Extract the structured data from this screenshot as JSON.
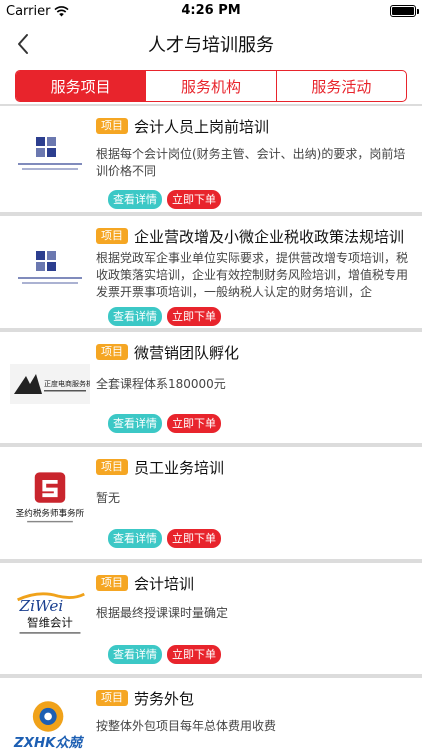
{
  "status": {
    "carrier": "Carrier",
    "time": "4:26 PM",
    "battery_level": 1.0
  },
  "nav": {
    "title": "人才与培训服务",
    "back_icon": "chevron-left-icon"
  },
  "tabs": [
    {
      "label": "服务项目",
      "active": true
    },
    {
      "label": "服务机构",
      "active": false
    },
    {
      "label": "服务活动",
      "active": false
    }
  ],
  "items": [
    {
      "tag": "项目",
      "title": "会计人员上岗前培训",
      "desc": "根据每个会计岗位(财务主管、会计、出纳)的要求，岗前培训价格不同",
      "detail_label": "查看详情",
      "order_label": "立即下单",
      "logo": "zhiyue-logo"
    },
    {
      "tag": "项目",
      "title": "企业营改增及小微企业税收政策法规培训",
      "desc": "根据党政军企事业单位实际要求，提供营改增专项培训，税收政策落实培训，企业有效控制财务风险培训，增值税专用发票开票事项培训，一般纳税人认定的财务培训，企",
      "detail_label": "查看详情",
      "order_label": "立即下单",
      "logo": "zhiyue-logo"
    },
    {
      "tag": "项目",
      "title": "微营销团队孵化",
      "desc": "全套课程体系180000元",
      "detail_label": "查看详情",
      "order_label": "立即下单",
      "logo": "zhengdu-logo",
      "logo_text": "正度电商服务机构"
    },
    {
      "tag": "项目",
      "title": "员工业务培训",
      "desc": "暂无",
      "detail_label": "查看详情",
      "order_label": "立即下单",
      "logo": "shengyue-logo",
      "logo_text": "圣约税务师事务所"
    },
    {
      "tag": "项目",
      "title": "会计培训",
      "desc": "根据最终授课课时量确定",
      "detail_label": "查看详情",
      "order_label": "立即下单",
      "logo": "zhiwei-logo",
      "logo_text": "智维会计"
    },
    {
      "tag": "项目",
      "title": "劳务外包",
      "desc": "按整体外包项目每年总体费用收费",
      "detail_label": "查看详情",
      "order_label": "立即下单",
      "logo": "zxhk-logo",
      "logo_text": "ZXHK众兢"
    }
  ],
  "colors": {
    "accent": "#e8242c",
    "tag": "#f5a623",
    "detail": "#3cc8c6"
  }
}
